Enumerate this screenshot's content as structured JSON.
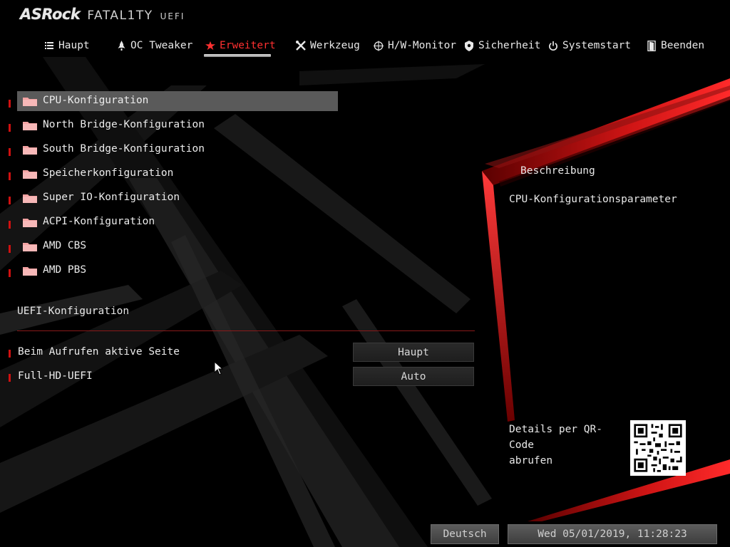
{
  "brand": {
    "name": "ASRock",
    "line": "FATAL1TY",
    "uefi": "UEFI"
  },
  "colors": {
    "accent": "#e01818",
    "active_tab": "#ff3030",
    "highlight": "#5a5a5a",
    "folder": "#f4a3a3"
  },
  "tabs": [
    {
      "label": "Haupt",
      "icon": "list-icon",
      "active": false
    },
    {
      "label": "OC Tweaker",
      "icon": "rocket-icon",
      "active": false
    },
    {
      "label": "Erweitert",
      "icon": "star-icon",
      "active": true
    },
    {
      "label": "Werkzeug",
      "icon": "tools-icon",
      "active": false
    },
    {
      "label": "H/W-Monitor",
      "icon": "crosshair-icon",
      "active": false
    },
    {
      "label": "Sicherheit",
      "icon": "shield-icon",
      "active": false
    },
    {
      "label": "Systemstart",
      "icon": "power-icon",
      "active": false
    },
    {
      "label": "Beenden",
      "icon": "exit-door-icon",
      "active": false
    }
  ],
  "menu": {
    "items": [
      {
        "label": "CPU-Konfiguration",
        "selected": true
      },
      {
        "label": "North Bridge-Konfiguration",
        "selected": false
      },
      {
        "label": "South Bridge-Konfiguration",
        "selected": false
      },
      {
        "label": "Speicherkonfiguration",
        "selected": false
      },
      {
        "label": "Super IO-Konfiguration",
        "selected": false
      },
      {
        "label": "ACPI-Konfiguration",
        "selected": false
      },
      {
        "label": "AMD CBS",
        "selected": false
      },
      {
        "label": "AMD PBS",
        "selected": false
      }
    ]
  },
  "uefi_section": {
    "title": "UEFI-Konfiguration",
    "options": [
      {
        "label": "Beim Aufrufen aktive Seite",
        "value": "Haupt"
      },
      {
        "label": "Full-HD-UEFI",
        "value": "Auto"
      }
    ]
  },
  "description": {
    "title": "Beschreibung",
    "text": "CPU-Konfigurationsparameter",
    "qr_line1": "Details per QR-Code",
    "qr_line2": "abrufen"
  },
  "footer": {
    "language": "Deutsch",
    "datetime": "Wed 05/01/2019, 11:28:23"
  }
}
